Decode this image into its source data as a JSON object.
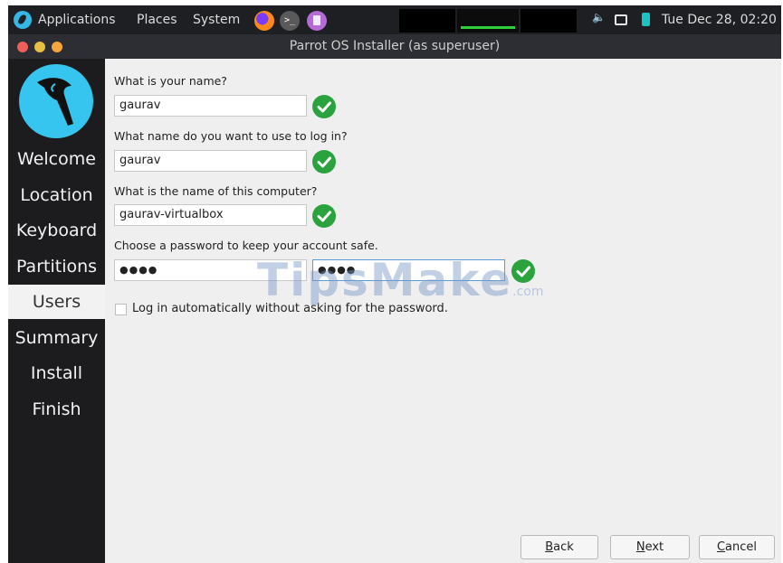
{
  "panel": {
    "menu": [
      "Applications",
      "Places",
      "System"
    ],
    "clock": "Tue Dec 28, 02:20",
    "terminal_glyph": ">_"
  },
  "window": {
    "title": "Parrot OS Installer (as superuser)"
  },
  "sidebar": {
    "steps": [
      "Welcome",
      "Location",
      "Keyboard",
      "Partitions",
      "Users",
      "Summary",
      "Install",
      "Finish"
    ],
    "active_step": "Users"
  },
  "form": {
    "name_label": "What is your name?",
    "name_value": "gaurav",
    "login_label": "What name do you want to use to log in?",
    "login_value": "gaurav",
    "computer_label": "What is the name of this computer?",
    "computer_value": "gaurav-virtualbox",
    "password_label": "Choose a password to keep your account safe.",
    "password_value": "●●●●",
    "password_confirm_value": "●●●●",
    "autologin_label": "Log in automatically without asking for the password.",
    "autologin_checked": false
  },
  "buttons": {
    "back": {
      "mnemonic": "B",
      "rest": "ack"
    },
    "next": {
      "mnemonic": "N",
      "rest": "ext"
    },
    "cancel": {
      "mnemonic": "C",
      "rest": "ancel"
    }
  },
  "watermark": {
    "text": "TipsMake",
    "suffix": ".com"
  },
  "colors": {
    "accent": "#36c5ee",
    "valid": "#2aa33e",
    "sidebar_bg": "#1c1c1e",
    "content_bg": "#efefef"
  }
}
